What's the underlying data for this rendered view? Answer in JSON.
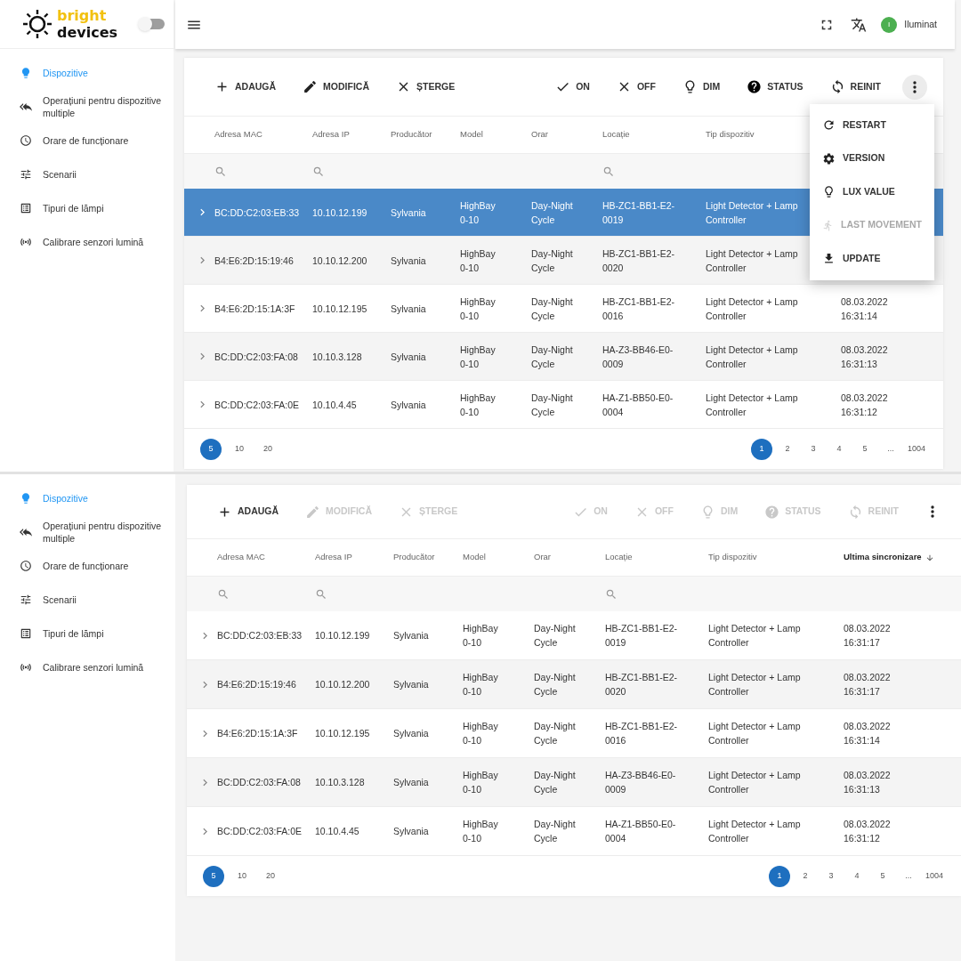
{
  "header": {
    "logo": {
      "word_1": "bright",
      "word_2": "devices"
    },
    "theme_toggle": {
      "on": false
    },
    "user": {
      "initial": "I",
      "name": "Iluminat"
    }
  },
  "panels": [
    {
      "sidebar": [
        {
          "kind": "devices",
          "label": "Dispozitive",
          "selected": true
        },
        {
          "kind": "multi",
          "label": "Operațiuni pentru dispozitive multiple",
          "selected": false
        },
        {
          "kind": "schedule",
          "label": "Orare de funcționare",
          "selected": false
        },
        {
          "kind": "scenes",
          "label": "Scenarii",
          "selected": false
        },
        {
          "kind": "lamps",
          "label": "Tipuri de lămpi",
          "selected": false
        },
        {
          "kind": "sensors",
          "label": "Calibrare senzori lumină",
          "selected": false
        }
      ],
      "toolbar": {
        "left": [
          {
            "kind": "add",
            "label": "ADAUGĂ",
            "disabled": false
          },
          {
            "kind": "edit",
            "label": "MODIFICĂ",
            "disabled": false
          },
          {
            "kind": "delete",
            "label": "ȘTERGE",
            "disabled": false
          }
        ],
        "right": [
          {
            "kind": "on",
            "label": "ON",
            "disabled": false
          },
          {
            "kind": "off",
            "label": "OFF",
            "disabled": false
          },
          {
            "kind": "dim",
            "label": "DIM",
            "disabled": false
          },
          {
            "kind": "status",
            "label": "STATUS",
            "disabled": false
          },
          {
            "kind": "reinit",
            "label": "REINIT",
            "disabled": false
          }
        ],
        "more": {
          "expanded": true
        }
      },
      "menu": [
        {
          "kind": "restart",
          "label": "RESTART",
          "disabled": false
        },
        {
          "kind": "version",
          "label": "VERSION",
          "disabled": false
        },
        {
          "kind": "lux",
          "label": "LUX VALUE",
          "disabled": false
        },
        {
          "kind": "movement",
          "label": "LAST MOVEMENT",
          "disabled": true
        },
        {
          "kind": "update",
          "label": "UPDATE",
          "disabled": false
        }
      ],
      "columns": [
        {
          "label": "Adresa MAC",
          "filter": true,
          "sorted": false
        },
        {
          "label": "Adresa IP",
          "filter": true,
          "sorted": false
        },
        {
          "label": "Producător",
          "filter": false,
          "sorted": false
        },
        {
          "label": "Model",
          "filter": false,
          "sorted": false
        },
        {
          "label": "Orar",
          "filter": false,
          "sorted": false
        },
        {
          "label": "Locație",
          "filter": true,
          "sorted": false
        },
        {
          "label": "Tip dispozitiv",
          "filter": false,
          "sorted": false
        }
      ],
      "rows": [
        {
          "mac": "BC:DD:C2:03:EB:33",
          "ip": "10.10.12.199",
          "producer": "Sylvania",
          "model": "HighBay 0-10",
          "schedule": "Day-Night Cycle",
          "location": "HB-ZC1-BB1-E2-0019",
          "device_type": "Light Detector + Lamp Controller",
          "selected": true
        },
        {
          "mac": "B4:E6:2D:15:19:46",
          "ip": "10.10.12.200",
          "producer": "Sylvania",
          "model": "HighBay 0-10",
          "schedule": "Day-Night Cycle",
          "location": "HB-ZC1-BB1-E2-0020",
          "device_type": "Light Detector + Lamp Controller",
          "selected": false
        },
        {
          "mac": "B4:E6:2D:15:1A:3F",
          "ip": "10.10.12.195",
          "producer": "Sylvania",
          "model": "HighBay 0-10",
          "schedule": "Day-Night Cycle",
          "location": "HB-ZC1-BB1-E2-0016",
          "device_type": "Light Detector + Lamp Controller",
          "synced": "08.03.2022 16:31:14",
          "selected": false
        },
        {
          "mac": "BC:DD:C2:03:FA:08",
          "ip": "10.10.3.128",
          "producer": "Sylvania",
          "model": "HighBay 0-10",
          "schedule": "Day-Night Cycle",
          "location": "HA-Z3-BB46-E0-0009",
          "device_type": "Light Detector + Lamp Controller",
          "synced": "08.03.2022 16:31:13",
          "selected": false
        },
        {
          "mac": "BC:DD:C2:03:FA:0E",
          "ip": "10.10.4.45",
          "producer": "Sylvania",
          "model": "HighBay 0-10",
          "schedule": "Day-Night Cycle",
          "location": "HA-Z1-BB50-E0-0004",
          "device_type": "Light Detector + Lamp Controller",
          "synced": "08.03.2022 16:31:12",
          "selected": false
        }
      ],
      "page_sizes": [
        {
          "label": "5",
          "selected": true
        },
        {
          "label": "10",
          "selected": false
        },
        {
          "label": "20",
          "selected": false
        }
      ],
      "pages": [
        {
          "label": "1",
          "selected": true
        },
        {
          "label": "2",
          "selected": false
        },
        {
          "label": "3",
          "selected": false
        },
        {
          "label": "4",
          "selected": false
        },
        {
          "label": "5",
          "selected": false
        },
        {
          "label": "...",
          "selected": false
        },
        {
          "label": "1004",
          "selected": false
        }
      ]
    },
    {
      "sidebar": [
        {
          "kind": "devices",
          "label": "Dispozitive",
          "selected": true
        },
        {
          "kind": "multi",
          "label": "Operațiuni pentru dispozitive multiple",
          "selected": false
        },
        {
          "kind": "schedule",
          "label": "Orare de funcționare",
          "selected": false
        },
        {
          "kind": "scenes",
          "label": "Scenarii",
          "selected": false
        },
        {
          "kind": "lamps",
          "label": "Tipuri de lămpi",
          "selected": false
        },
        {
          "kind": "sensors",
          "label": "Calibrare senzori lumină",
          "selected": false
        }
      ],
      "toolbar": {
        "left": [
          {
            "kind": "add",
            "label": "ADAUGĂ",
            "disabled": false
          },
          {
            "kind": "edit",
            "label": "MODIFICĂ",
            "disabled": true
          },
          {
            "kind": "delete",
            "label": "ȘTERGE",
            "disabled": true
          }
        ],
        "right": [
          {
            "kind": "on",
            "label": "ON",
            "disabled": true
          },
          {
            "kind": "off",
            "label": "OFF",
            "disabled": true
          },
          {
            "kind": "dim",
            "label": "DIM",
            "disabled": true
          },
          {
            "kind": "status",
            "label": "STATUS",
            "disabled": true
          },
          {
            "kind": "reinit",
            "label": "REINIT",
            "disabled": true
          }
        ],
        "more": {
          "expanded": false
        }
      },
      "columns": [
        {
          "label": "Adresa MAC",
          "filter": true,
          "sorted": false
        },
        {
          "label": "Adresa IP",
          "filter": true,
          "sorted": false
        },
        {
          "label": "Producător",
          "filter": false,
          "sorted": false
        },
        {
          "label": "Model",
          "filter": false,
          "sorted": false
        },
        {
          "label": "Orar",
          "filter": false,
          "sorted": false
        },
        {
          "label": "Locație",
          "filter": true,
          "sorted": false
        },
        {
          "label": "Tip dispozitiv",
          "filter": false,
          "sorted": false
        },
        {
          "label": "Ultima sincronizare",
          "filter": false,
          "sorted": true
        }
      ],
      "rows": [
        {
          "mac": "BC:DD:C2:03:EB:33",
          "ip": "10.10.12.199",
          "producer": "Sylvania",
          "model": "HighBay 0-10",
          "schedule": "Day-Night Cycle",
          "location": "HB-ZC1-BB1-E2-0019",
          "device_type": "Light Detector + Lamp Controller",
          "synced": "08.03.2022 16:31:17",
          "selected": false
        },
        {
          "mac": "B4:E6:2D:15:19:46",
          "ip": "10.10.12.200",
          "producer": "Sylvania",
          "model": "HighBay 0-10",
          "schedule": "Day-Night Cycle",
          "location": "HB-ZC1-BB1-E2-0020",
          "device_type": "Light Detector + Lamp Controller",
          "synced": "08.03.2022 16:31:17",
          "selected": false
        },
        {
          "mac": "B4:E6:2D:15:1A:3F",
          "ip": "10.10.12.195",
          "producer": "Sylvania",
          "model": "HighBay 0-10",
          "schedule": "Day-Night Cycle",
          "location": "HB-ZC1-BB1-E2-0016",
          "device_type": "Light Detector + Lamp Controller",
          "synced": "08.03.2022 16:31:14",
          "selected": false
        },
        {
          "mac": "BC:DD:C2:03:FA:08",
          "ip": "10.10.3.128",
          "producer": "Sylvania",
          "model": "HighBay 0-10",
          "schedule": "Day-Night Cycle",
          "location": "HA-Z3-BB46-E0-0009",
          "device_type": "Light Detector + Lamp Controller",
          "synced": "08.03.2022 16:31:13",
          "selected": false
        },
        {
          "mac": "BC:DD:C2:03:FA:0E",
          "ip": "10.10.4.45",
          "producer": "Sylvania",
          "model": "HighBay 0-10",
          "schedule": "Day-Night Cycle",
          "location": "HA-Z1-BB50-E0-0004",
          "device_type": "Light Detector + Lamp Controller",
          "synced": "08.03.2022 16:31:12",
          "selected": false
        }
      ],
      "page_sizes": [
        {
          "label": "5",
          "selected": true
        },
        {
          "label": "10",
          "selected": false
        },
        {
          "label": "20",
          "selected": false
        }
      ],
      "pages": [
        {
          "label": "1",
          "selected": true
        },
        {
          "label": "2",
          "selected": false
        },
        {
          "label": "3",
          "selected": false
        },
        {
          "label": "4",
          "selected": false
        },
        {
          "label": "5",
          "selected": false
        },
        {
          "label": "...",
          "selected": false
        },
        {
          "label": "1004",
          "selected": false
        }
      ]
    }
  ]
}
